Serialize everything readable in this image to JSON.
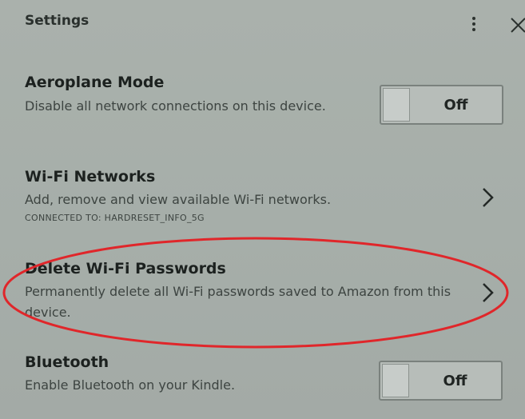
{
  "header": {
    "title": "Settings",
    "more_icon": "more-vertical-icon",
    "close_icon": "close-icon"
  },
  "settings": [
    {
      "title": "Aeroplane Mode",
      "description": "Disable all network connections on this device.",
      "control": "toggle",
      "toggle_label": "Off"
    },
    {
      "title": "Wi-Fi Networks",
      "description": "Add, remove and view available Wi-Fi networks.",
      "status": "CONNECTED TO: HARDRESET_INFO_5G",
      "control": "chevron"
    },
    {
      "title": "Delete Wi-Fi Passwords",
      "description": "Permanently delete all Wi-Fi passwords saved to Amazon from this device.",
      "control": "chevron"
    },
    {
      "title": "Bluetooth",
      "description": "Enable Bluetooth on your Kindle.",
      "control": "toggle",
      "toggle_label": "Off"
    }
  ],
  "annotation": {
    "type": "red-ellipse-highlight",
    "color": "#e0262a",
    "target": "Delete Wi-Fi Passwords"
  },
  "colors": {
    "background": "#a9b0ab",
    "text": "#1d2220"
  }
}
